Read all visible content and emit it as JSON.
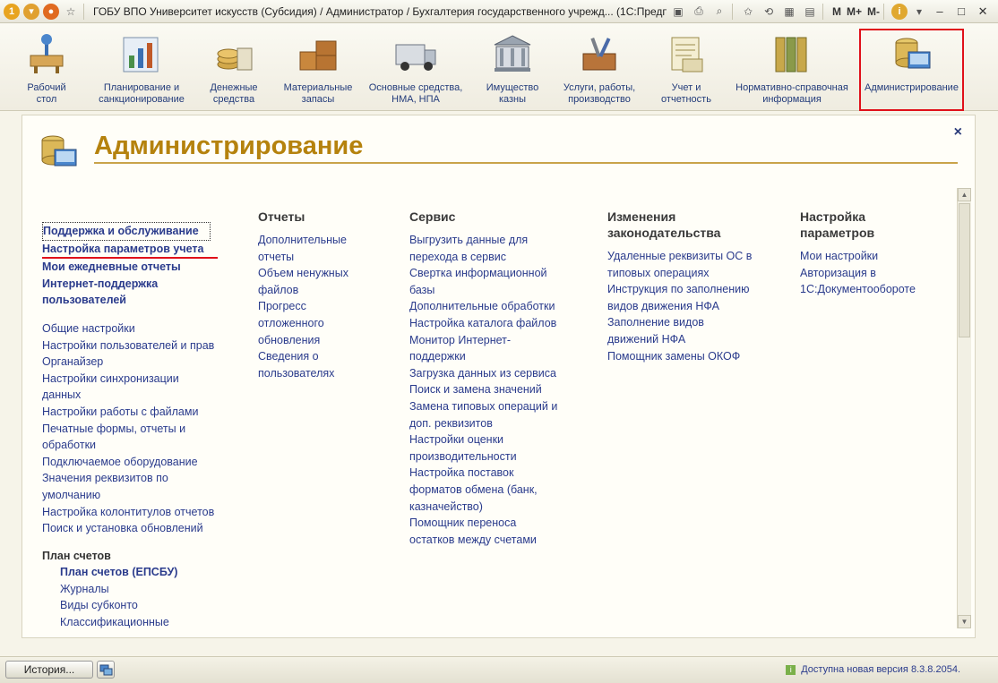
{
  "window": {
    "title": "ГОБУ ВПО Университет искусств (Субсидия) / Администратор / Бухгалтерия государственного учрежд...  (1С:Предприятие)",
    "m_buttons": [
      "M",
      "M+",
      "M-"
    ]
  },
  "sections": [
    {
      "label": "Рабочий\nстол",
      "icon": "desk-icon"
    },
    {
      "label": "Планирование и\nсанкционирование",
      "icon": "planning-icon"
    },
    {
      "label": "Денежные\nсредства",
      "icon": "coins-icon"
    },
    {
      "label": "Материальные\nзапасы",
      "icon": "boxes-icon"
    },
    {
      "label": "Основные средства,\nНМА, НПА",
      "icon": "truck-icon"
    },
    {
      "label": "Имущество\nказны",
      "icon": "building-icon"
    },
    {
      "label": "Услуги, работы,\nпроизводство",
      "icon": "tools-icon"
    },
    {
      "label": "Учет и\nотчетность",
      "icon": "report-icon"
    },
    {
      "label": "Нормативно-справочная\nинформация",
      "icon": "binders-icon"
    },
    {
      "label": "Администрирование",
      "icon": "admin-icon",
      "active": true
    }
  ],
  "panel": {
    "title": "Администрирование",
    "close_label": "×"
  },
  "col1": {
    "bold_links": [
      "Поддержка и обслуживание",
      "Настройка параметров учета",
      "Мои ежедневные отчеты",
      "Интернет-поддержка\nпользователей"
    ],
    "links": [
      "Общие настройки",
      "Настройки пользователей и прав",
      "Органайзер",
      "Настройки синхронизации\nданных",
      "Настройки работы с файлами",
      "Печатные формы, отчеты и\nобработки",
      "Подключаемое оборудование",
      "Значения реквизитов по\nумолчанию",
      "Настройка колонтитулов отчетов",
      "Поиск и установка обновлений"
    ],
    "group_heading": "План счетов",
    "group_bold_link": "План счетов (ЕПСБУ)",
    "group_links": [
      "Журналы",
      "Виды субконто",
      "Классификационные"
    ]
  },
  "col2": {
    "heading": "Отчеты",
    "links": [
      "Дополнительные\nотчеты",
      "Объем ненужных\nфайлов",
      "Прогресс\nотложенного\nобновления",
      "Сведения о\nпользователях"
    ]
  },
  "col3": {
    "heading": "Сервис",
    "links": [
      "Выгрузить данные для\nперехода в сервис",
      "Свертка информационной\nбазы",
      "Дополнительные обработки",
      "Настройка каталога файлов",
      "Монитор Интернет-\nподдержки",
      "Загрузка данных из сервиса",
      "Поиск и замена значений",
      "Замена типовых операций и\nдоп. реквизитов",
      "Настройки оценки\nпроизводительности",
      "Настройка поставок\nформатов обмена (банк,\nказначейство)",
      "Помощник переноса\nостатков между счетами"
    ]
  },
  "col4": {
    "heading": "Изменения\nзаконодательства",
    "links": [
      "Удаленные реквизиты ОС в\nтиповых операциях",
      "Инструкция по заполнению\nвидов движения НФА",
      "Заполнение видов\nдвижений НФА",
      "Помощник замены ОКОФ"
    ]
  },
  "col5": {
    "heading": "Настройка\nпараметров",
    "links": [
      "Мои настройки",
      "Авторизация в\n1С:Документообороте"
    ]
  },
  "statusbar": {
    "history_label": "История...",
    "info_text": "Доступна новая версия 8.3.8.2054."
  },
  "colors": {
    "title_accent": "#b5820d",
    "link": "#2a3b8c",
    "active_border": "#e0101a"
  }
}
